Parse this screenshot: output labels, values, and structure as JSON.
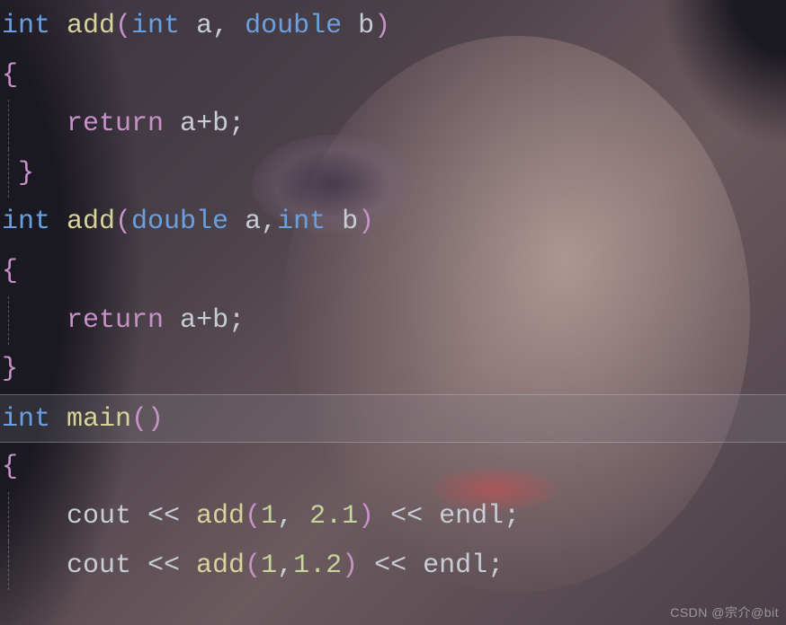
{
  "code": {
    "lines": [
      {
        "indent": 0,
        "tokens": [
          {
            "t": "int ",
            "c": "kw"
          },
          {
            "t": "add",
            "c": "fn"
          },
          {
            "t": "(",
            "c": "br"
          },
          {
            "t": "int ",
            "c": "kw"
          },
          {
            "t": "a",
            "c": "id"
          },
          {
            "t": ", ",
            "c": "pn"
          },
          {
            "t": "double ",
            "c": "kw"
          },
          {
            "t": "b",
            "c": "id"
          },
          {
            "t": ")",
            "c": "br"
          }
        ]
      },
      {
        "indent": 0,
        "tokens": [
          {
            "t": "{",
            "c": "br"
          }
        ]
      },
      {
        "indent": 1,
        "guide": true,
        "tokens": [
          {
            "t": "return ",
            "c": "ret"
          },
          {
            "t": "a",
            "c": "id"
          },
          {
            "t": "+",
            "c": "op"
          },
          {
            "t": "b",
            "c": "id"
          },
          {
            "t": ";",
            "c": "pn"
          }
        ]
      },
      {
        "indent": 0,
        "guide": true,
        "tokens": [
          {
            "t": " }",
            "c": "br"
          }
        ]
      },
      {
        "indent": 0,
        "tokens": [
          {
            "t": "int ",
            "c": "kw"
          },
          {
            "t": "add",
            "c": "fn"
          },
          {
            "t": "(",
            "c": "br"
          },
          {
            "t": "double ",
            "c": "kw"
          },
          {
            "t": "a",
            "c": "id"
          },
          {
            "t": ",",
            "c": "pn"
          },
          {
            "t": "int ",
            "c": "kw"
          },
          {
            "t": "b",
            "c": "id"
          },
          {
            "t": ")",
            "c": "br"
          }
        ]
      },
      {
        "indent": 0,
        "tokens": [
          {
            "t": "{",
            "c": "br"
          }
        ]
      },
      {
        "indent": 1,
        "guide": true,
        "tokens": [
          {
            "t": "return ",
            "c": "ret"
          },
          {
            "t": "a",
            "c": "id"
          },
          {
            "t": "+",
            "c": "op"
          },
          {
            "t": "b",
            "c": "id"
          },
          {
            "t": ";",
            "c": "pn"
          }
        ]
      },
      {
        "indent": 0,
        "tokens": [
          {
            "t": "}",
            "c": "br"
          }
        ]
      },
      {
        "indent": 0,
        "highlight": true,
        "tokens": [
          {
            "t": "int ",
            "c": "kw"
          },
          {
            "t": "main",
            "c": "fn"
          },
          {
            "t": "()",
            "c": "br"
          }
        ]
      },
      {
        "indent": 0,
        "tokens": [
          {
            "t": "{",
            "c": "br"
          }
        ]
      },
      {
        "indent": 1,
        "guide": true,
        "tokens": [
          {
            "t": "cout ",
            "c": "id"
          },
          {
            "t": "<< ",
            "c": "op"
          },
          {
            "t": "add",
            "c": "fn"
          },
          {
            "t": "(",
            "c": "br"
          },
          {
            "t": "1",
            "c": "num"
          },
          {
            "t": ", ",
            "c": "pn"
          },
          {
            "t": "2.1",
            "c": "num"
          },
          {
            "t": ")",
            "c": "br"
          },
          {
            "t": " << ",
            "c": "op"
          },
          {
            "t": "endl",
            "c": "id"
          },
          {
            "t": ";",
            "c": "pn"
          }
        ]
      },
      {
        "indent": 1,
        "guide": true,
        "tokens": [
          {
            "t": "cout ",
            "c": "id"
          },
          {
            "t": "<< ",
            "c": "op"
          },
          {
            "t": "add",
            "c": "fn"
          },
          {
            "t": "(",
            "c": "br"
          },
          {
            "t": "1",
            "c": "num"
          },
          {
            "t": ",",
            "c": "pn"
          },
          {
            "t": "1.2",
            "c": "num"
          },
          {
            "t": ")",
            "c": "br"
          },
          {
            "t": " << ",
            "c": "op"
          },
          {
            "t": "endl",
            "c": "id"
          },
          {
            "t": ";",
            "c": "pn"
          }
        ]
      }
    ]
  },
  "watermark": "CSDN @宗介@bit"
}
